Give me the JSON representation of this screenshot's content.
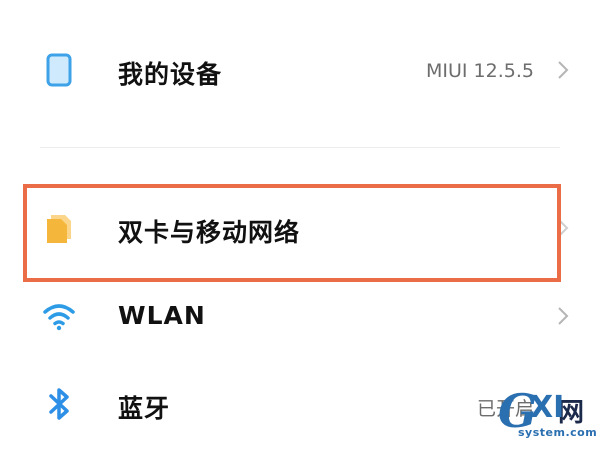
{
  "settings": {
    "items": [
      {
        "label": "我的设备",
        "value": "MIUI 12.5.5",
        "icon": "device-icon"
      },
      {
        "label": "双卡与移动网络",
        "value": "",
        "icon": "sim-card-icon"
      },
      {
        "label": "WLAN",
        "value": "",
        "icon": "wifi-icon"
      },
      {
        "label": "蓝牙",
        "value": "已开启",
        "icon": "bluetooth-icon"
      }
    ]
  },
  "colors": {
    "highlight": "#ea6d47",
    "device_icon": "#3da2e8",
    "sim_icon": "#f5b73b",
    "wifi_icon": "#2d9be6",
    "bluetooth_icon": "#2d8fe6"
  },
  "watermark": {
    "brand": "GXI",
    "net": "网",
    "domain": "system.com"
  }
}
